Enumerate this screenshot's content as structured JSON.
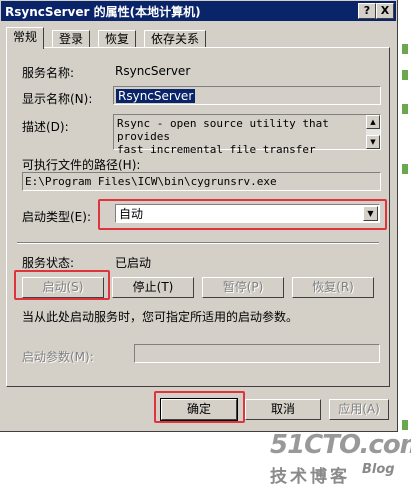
{
  "window": {
    "title": "RsyncServer 的属性(本地计算机)",
    "help_button": "?",
    "close_button": "X"
  },
  "tabs": [
    "常规",
    "登录",
    "恢复",
    "依存关系"
  ],
  "general": {
    "service_name_label": "服务名称:",
    "service_name_value": "RsyncServer",
    "display_name_label": "显示名称(N):",
    "display_name_value": "RsyncServer",
    "description_label": "描述(D):",
    "description_lines": [
      "Rsync - open source utility that provides",
      "fast incremental file transfer"
    ],
    "exe_path_label": "可执行文件的路径(H):",
    "exe_path_value": "E:\\Program Files\\ICW\\bin\\cygrunsrv.exe",
    "startup_type_label": "启动类型(E):",
    "startup_type_value": "自动",
    "status_label": "服务状态:",
    "status_value": "已启动",
    "buttons": {
      "start": "启动(S)",
      "stop": "停止(T)",
      "pause": "暂停(P)",
      "resume": "恢复(R)"
    },
    "hint": "当从此处启动服务时，您可指定所适用的启动参数。",
    "start_params_label": "启动参数(M):"
  },
  "footer": {
    "ok": "确定",
    "cancel": "取消",
    "apply": "应用(A)"
  },
  "watermark": {
    "line1": "51CTO.com",
    "line2": "技术博客",
    "line3": "Blog"
  },
  "colors": {
    "highlight_box": "#e0343c",
    "title_bar": "#0a246a",
    "dialog_face": "#d4d0c8"
  }
}
